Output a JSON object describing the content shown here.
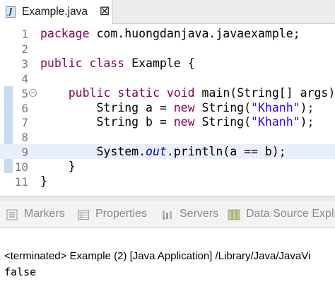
{
  "editor_tab": {
    "file_icon_letter": "J",
    "label": "Example.java",
    "close_glyph": "⊠"
  },
  "code_lines": [
    {
      "number": "1",
      "tokens": [
        {
          "t": "package",
          "c": "kw"
        },
        {
          "t": " com.huongdanjava.javaexample;",
          "c": ""
        }
      ]
    },
    {
      "number": "2",
      "tokens": []
    },
    {
      "number": "3",
      "tokens": [
        {
          "t": "public",
          "c": "kw"
        },
        {
          "t": " ",
          "c": ""
        },
        {
          "t": "class",
          "c": "kw"
        },
        {
          "t": " Example {",
          "c": ""
        }
      ]
    },
    {
      "number": "4",
      "tokens": []
    },
    {
      "number": "5",
      "tokens": [
        {
          "t": "    ",
          "c": ""
        },
        {
          "t": "public",
          "c": "kw"
        },
        {
          "t": " ",
          "c": ""
        },
        {
          "t": "static",
          "c": "kw"
        },
        {
          "t": " ",
          "c": ""
        },
        {
          "t": "void",
          "c": "kw"
        },
        {
          "t": " main(String[] args) {",
          "c": ""
        }
      ],
      "fold": true
    },
    {
      "number": "6",
      "tokens": [
        {
          "t": "        String a = ",
          "c": ""
        },
        {
          "t": "new",
          "c": "kw"
        },
        {
          "t": " String(",
          "c": ""
        },
        {
          "t": "\"Khanh\"",
          "c": "str"
        },
        {
          "t": ");",
          "c": ""
        }
      ]
    },
    {
      "number": "7",
      "tokens": [
        {
          "t": "        String b = ",
          "c": ""
        },
        {
          "t": "new",
          "c": "kw"
        },
        {
          "t": " String(",
          "c": ""
        },
        {
          "t": "\"Khanh\"",
          "c": "str"
        },
        {
          "t": ");",
          "c": ""
        }
      ]
    },
    {
      "number": "8",
      "tokens": []
    },
    {
      "number": "9",
      "tokens": [
        {
          "t": "        System.",
          "c": ""
        },
        {
          "t": "out",
          "c": "static-field"
        },
        {
          "t": ".println(a == b);",
          "c": ""
        }
      ],
      "current": true
    },
    {
      "number": "10",
      "tokens": [
        {
          "t": "    }",
          "c": ""
        }
      ]
    },
    {
      "number": "11",
      "tokens": [
        {
          "t": "}",
          "c": ""
        }
      ]
    }
  ],
  "panel_tabs": [
    {
      "label": "Markers",
      "icon": "markers-icon"
    },
    {
      "label": "Properties",
      "icon": "properties-icon"
    },
    {
      "label": "Servers",
      "icon": "servers-icon"
    },
    {
      "label": "Data Source Expl",
      "icon": "data-source-explorer-icon"
    }
  ],
  "console": {
    "status": "<terminated> Example (2) [Java Application] /Library/Java/JavaVi",
    "output": "false"
  },
  "colors": {
    "keyword": "#7f0055",
    "string": "#2a00ff",
    "static_field": "#0000c0",
    "current_line": "#e9f0fb"
  }
}
